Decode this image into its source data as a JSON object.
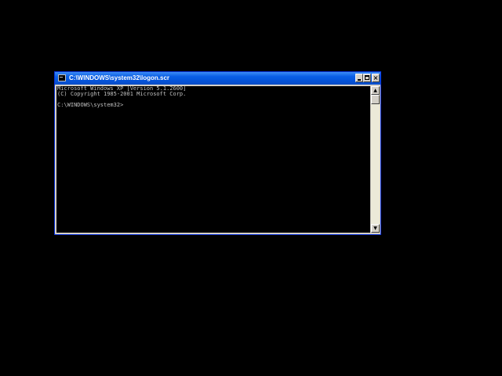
{
  "window": {
    "title": "C:\\WINDOWS\\system32\\logon.scr",
    "title_icon": "console-icon",
    "buttons": {
      "minimize_icon": "minimize-icon",
      "maximize_icon": "maximize-icon",
      "close_label": "×"
    }
  },
  "console": {
    "lines": [
      "Microsoft Windows XP [Version 5.1.2600]",
      "(C) Copyright 1985-2001 Microsoft Corp.",
      "",
      "C:\\WINDOWS\\system32>"
    ]
  },
  "scrollbar": {
    "up_arrow": "▲",
    "down_arrow": "▼"
  },
  "colors": {
    "desktop": "#000000",
    "titlebar": "#0a5fe6",
    "console_bg": "#000000",
    "console_text": "#c0c0c0"
  }
}
